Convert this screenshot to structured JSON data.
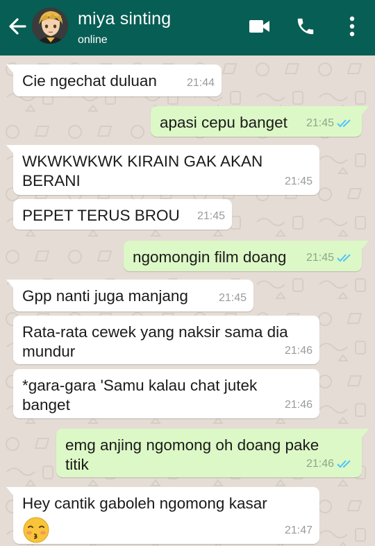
{
  "header": {
    "contact_name": "miya sinting",
    "status": "online",
    "bg_color": "#075e54",
    "back_icon": "arrow-left-icon",
    "video_icon": "video-camera-icon",
    "call_icon": "phone-icon",
    "menu_icon": "more-vert-icon"
  },
  "chat": {
    "messages": [
      {
        "dir": "in",
        "text": "Cie ngechat duluan",
        "time": "21:44"
      },
      {
        "dir": "out",
        "text": "apasi cepu banget",
        "time": "21:45",
        "read": true
      },
      {
        "dir": "in",
        "text": "WKWKWKWK KIRAIN GAK AKAN BERANI",
        "time": "21:45"
      },
      {
        "dir": "in",
        "text": "PEPET TERUS BROU",
        "time": "21:45"
      },
      {
        "dir": "out",
        "text": "ngomongin film doang",
        "time": "21:45",
        "read": true
      },
      {
        "dir": "in",
        "text": "Gpp nanti juga manjang",
        "time": "21:45"
      },
      {
        "dir": "in",
        "text": "Rata-rata cewek yang naksir sama dia mundur",
        "time": "21:46"
      },
      {
        "dir": "in",
        "text": "*gara-gara 'Samu kalau chat jutek banget",
        "time": "21:46"
      },
      {
        "dir": "out",
        "text": "emg anjing ngomong oh doang pake titik",
        "time": "21:46",
        "read": true
      },
      {
        "dir": "in",
        "text": "Hey cantik gaboleh ngomong kasar",
        "emoji": "kissing-face-emoji",
        "time": "21:47"
      }
    ],
    "colors": {
      "incoming": "#ffffff",
      "outgoing": "#dcf8c6",
      "read_ticks": "#4fc3f7",
      "wallpaper": "#e5ddd5"
    }
  }
}
